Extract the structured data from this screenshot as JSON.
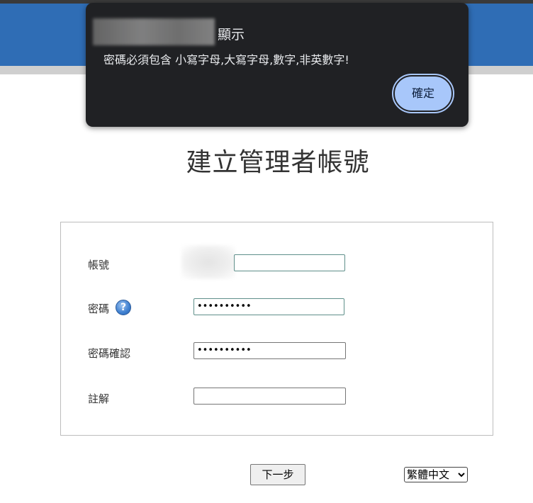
{
  "dialog": {
    "title": "顯示",
    "message": "密碼必須包含 小寫字母,大寫字母,數字,非英數字!",
    "ok_label": "確定"
  },
  "page": {
    "title": "建立管理者帳號"
  },
  "form": {
    "account_label": "帳號",
    "account_value": "",
    "password_label": "密碼",
    "password_value": "••••••••••",
    "confirm_label": "密碼確認",
    "confirm_value": "••••••••••",
    "note_label": "註解",
    "note_value": ""
  },
  "footer": {
    "next_label": "下一步",
    "language_selected": "繁體中文"
  },
  "icons": {
    "help": "help-icon",
    "dropdown": "chevron-down-icon"
  },
  "colors": {
    "header_blue": "#2f6db5",
    "dialog_bg": "#202124",
    "dialog_button": "#a8c7fa"
  }
}
